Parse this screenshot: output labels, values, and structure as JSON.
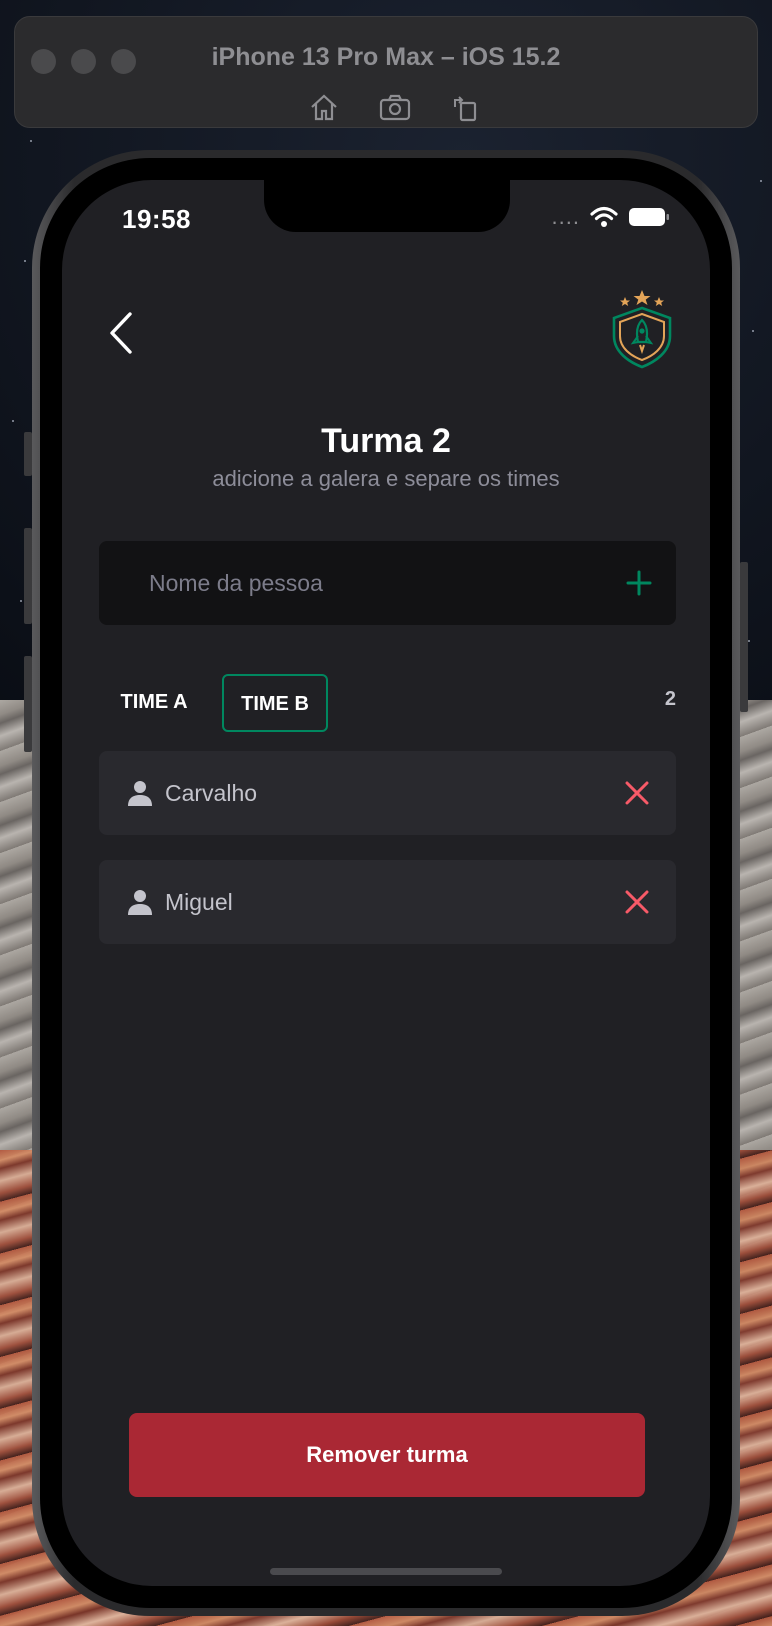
{
  "simulator": {
    "title": "iPhone 13 Pro Max – iOS 15.2",
    "toolbar": [
      {
        "icon": "home-icon"
      },
      {
        "icon": "screenshot-icon"
      },
      {
        "icon": "rotate-icon"
      }
    ]
  },
  "status_bar": {
    "time": "19:58",
    "signal": "....",
    "icons": [
      "wifi-icon",
      "battery-icon"
    ]
  },
  "header": {
    "back_icon": "chevron-left-icon",
    "logo_icon": "rocket-shield-logo"
  },
  "page": {
    "title": "Turma 2",
    "subtitle": "adicione a galera e separe os times"
  },
  "add_player": {
    "placeholder": "Nome da pessoa",
    "value": "",
    "button_icon": "plus-icon"
  },
  "teams": {
    "tabs": [
      {
        "label": "TIME A",
        "selected": false
      },
      {
        "label": "TIME B",
        "selected": true
      }
    ],
    "player_count": "2"
  },
  "players": [
    {
      "name": "Carvalho"
    },
    {
      "name": "Miguel"
    }
  ],
  "actions": {
    "remove_class_label": "Remover turma"
  },
  "colors": {
    "background": "#202024",
    "input_bg": "#121214",
    "card_bg": "#29292e",
    "accent_green": "#00875f",
    "danger_red": "#aa2834",
    "remove_icon_red": "#f75a68",
    "logo_orange": "#e3a458"
  }
}
